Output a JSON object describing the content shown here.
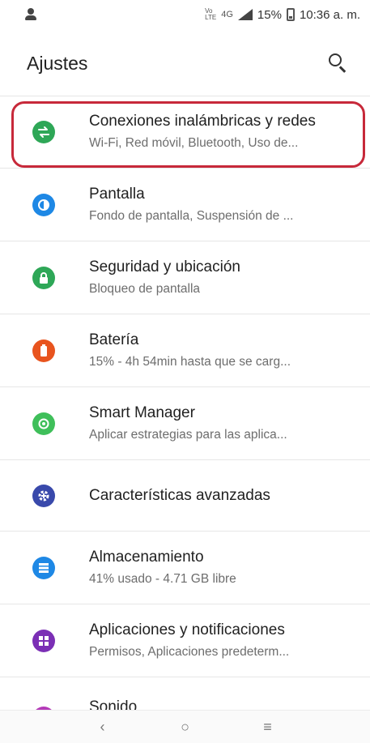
{
  "status_bar": {
    "volte_top": "Vo",
    "volte_bottom": "LTE",
    "network": "4G",
    "battery_percent": "15%",
    "time": "10:36 a. m."
  },
  "app_bar": {
    "title": "Ajustes"
  },
  "settings": [
    {
      "title": "Conexiones inalámbricas y redes",
      "subtitle": "Wi-Fi, Red móvil, Bluetooth, Uso de...",
      "icon": "swap-arrows-icon",
      "color": "#2ea757"
    },
    {
      "title": "Pantalla",
      "subtitle": "Fondo de pantalla, Suspensión de ...",
      "icon": "brightness-icon",
      "color": "#1e88e5"
    },
    {
      "title": "Seguridad y ubicación",
      "subtitle": "Bloqueo de pantalla",
      "icon": "lock-icon",
      "color": "#2ea757"
    },
    {
      "title": "Batería",
      "subtitle": "15% - 4h 54min hasta que se carg...",
      "icon": "battery-icon",
      "color": "#e8541e"
    },
    {
      "title": "Smart Manager",
      "subtitle": "Aplicar estrategias para las aplica...",
      "icon": "smart-manager-icon",
      "color": "#3fbf5a"
    },
    {
      "title": "Características avanzadas",
      "subtitle": "",
      "icon": "gear-plus-icon",
      "color": "#3949ab"
    },
    {
      "title": "Almacenamiento",
      "subtitle": "41% usado - 4.71 GB libre",
      "icon": "storage-icon",
      "color": "#1e88e5"
    },
    {
      "title": "Aplicaciones y notificaciones",
      "subtitle": "Permisos, Aplicaciones predeterm...",
      "icon": "apps-grid-icon",
      "color": "#7b2fb5"
    }
  ],
  "partial_item": {
    "title": "Sonido",
    "icon": "sound-icon",
    "color": "#b43ab8"
  },
  "nav_bar": {
    "back": "‹",
    "home": "○",
    "menu": "≡"
  },
  "colors": {
    "highlight": "#c7293a"
  }
}
